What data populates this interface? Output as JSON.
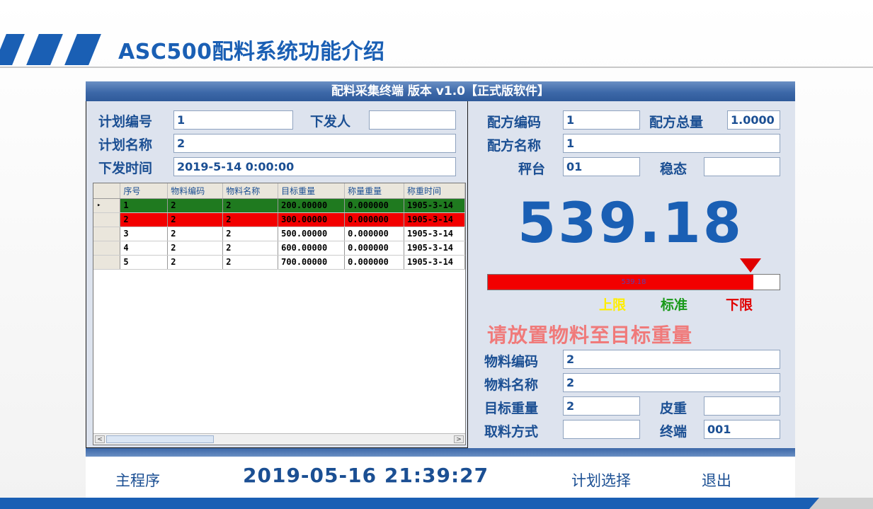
{
  "slide": {
    "title": "ASC500配料系统功能介绍"
  },
  "window": {
    "title": "配料采集终端 版本 v1.0【正式版软件】"
  },
  "plan": {
    "plan_no_label": "计划编号",
    "plan_no": "1",
    "issuer_label": "下发人",
    "issuer": "",
    "plan_name_label": "计划名称",
    "plan_name": "2",
    "issue_time_label": "下发时间",
    "issue_time": "2019-5-14 0:00:00"
  },
  "grid": {
    "columns": [
      "序号",
      "物料编码",
      "物料名称",
      "目标重量",
      "称量重量",
      "称重时间"
    ],
    "rows": [
      {
        "marker": "▸",
        "cells": [
          "1",
          "2",
          "2",
          "200.00000",
          "0.000000",
          "1905-3-14"
        ]
      },
      {
        "marker": "",
        "cells": [
          "2",
          "2",
          "2",
          "300.00000",
          "0.000000",
          "1905-3-14"
        ]
      },
      {
        "marker": "",
        "cells": [
          "3",
          "2",
          "2",
          "500.00000",
          "0.000000",
          "1905-3-14"
        ]
      },
      {
        "marker": "",
        "cells": [
          "4",
          "2",
          "2",
          "600.00000",
          "0.000000",
          "1905-3-14"
        ]
      },
      {
        "marker": "",
        "cells": [
          "5",
          "2",
          "2",
          "700.00000",
          "0.000000",
          "1905-3-14"
        ]
      }
    ],
    "scroll_left": "<",
    "scroll_right": ">"
  },
  "recipe": {
    "code_label": "配方编码",
    "code": "1",
    "total_label": "配方总量",
    "total": "1.0000",
    "name_label": "配方名称",
    "name": "1",
    "scale_label": "秤台",
    "scale": "01",
    "stable_label": "稳态",
    "stable": ""
  },
  "weight": {
    "value": "539.18",
    "bar_text": "539.18",
    "bar_fill_fraction": 0.91,
    "upper_label": "上限",
    "standard_label": "标准",
    "lower_label": "下限",
    "upper_color": "#ffee00",
    "standard_color": "#1a9a1a",
    "lower_color": "#e00000"
  },
  "prompt": "请放置物料至目标重量",
  "material": {
    "code_label": "物料编码",
    "code": "2",
    "name_label": "物料名称",
    "name": "2",
    "target_label": "目标重量",
    "target": "2",
    "tare_label": "皮重",
    "tare": "",
    "method_label": "取料方式",
    "method": "",
    "terminal_label": "终端",
    "terminal": "001"
  },
  "status": {
    "main_program": "主程序",
    "datetime": "2019-05-16 21:39:27",
    "plan_select": "计划选择",
    "exit": "退出"
  }
}
